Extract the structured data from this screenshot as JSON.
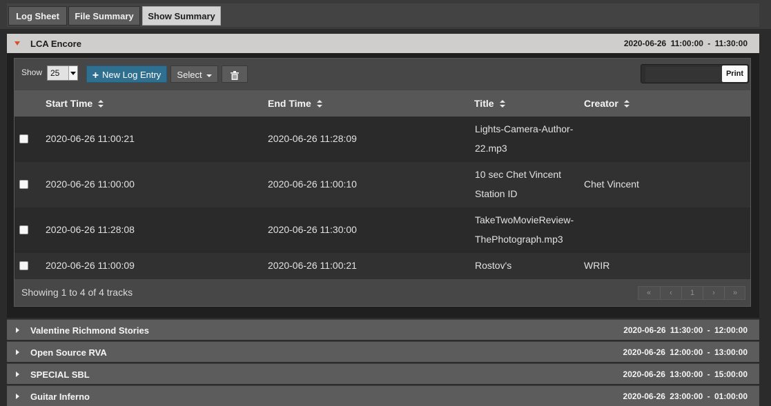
{
  "tabs": [
    {
      "label": "Log Sheet",
      "active": false
    },
    {
      "label": "File Summary",
      "active": false
    },
    {
      "label": "Show Summary",
      "active": true
    }
  ],
  "open_show": {
    "name": "LCA Encore",
    "date": "2020-06-26",
    "time_range": "11:00:00 - 11:30:00"
  },
  "toolbar": {
    "show_label": "Show",
    "page_size": "25",
    "new_log_label": "New Log Entry",
    "select_label": "Select",
    "trash_icon": "trash-icon",
    "print_label": "Print",
    "print_value": ""
  },
  "table": {
    "headers": [
      "Start Time",
      "End Time",
      "Title",
      "Creator"
    ],
    "rows": [
      {
        "start": "2020-06-26 11:00:21",
        "end": "2020-06-26 11:28:09",
        "title_lines": [
          "Lights-Camera-Author-",
          "22.mp3"
        ],
        "creator": ""
      },
      {
        "start": "2020-06-26 11:00:00",
        "end": "2020-06-26 11:00:10",
        "title_lines": [
          "10 sec Chet Vincent",
          "Station ID"
        ],
        "creator": "Chet Vincent"
      },
      {
        "start": "2020-06-26 11:28:08",
        "end": "2020-06-26 11:30:00",
        "title_lines": [
          "TakeTwoMovieReview-",
          "ThePhotograph.mp3"
        ],
        "creator": ""
      },
      {
        "start": "2020-06-26 11:00:09",
        "end": "2020-06-26 11:00:21",
        "title_lines": [
          "Rostov's"
        ],
        "creator": "WRIR"
      }
    ],
    "footer": "Showing 1 to 4 of 4 tracks",
    "pager": [
      "«",
      "‹",
      "1",
      "›",
      "»"
    ]
  },
  "other_shows": [
    {
      "name": "Valentine Richmond Stories",
      "date": "2020-06-26",
      "time_range": "11:30:00 - 12:00:00"
    },
    {
      "name": "Open Source RVA",
      "date": "2020-06-26",
      "time_range": "12:00:00 - 13:00:00"
    },
    {
      "name": "SPECIAL SBL",
      "date": "2020-06-26",
      "time_range": "13:00:00 - 15:00:00"
    },
    {
      "name": "Guitar Inferno",
      "date": "2020-06-26",
      "time_range": "23:00:00 - 01:00:00"
    }
  ],
  "colors": {
    "accent_caret": "#d7502a",
    "new_button": "#2f6f8f",
    "active_tab": "#d3d3d3"
  }
}
